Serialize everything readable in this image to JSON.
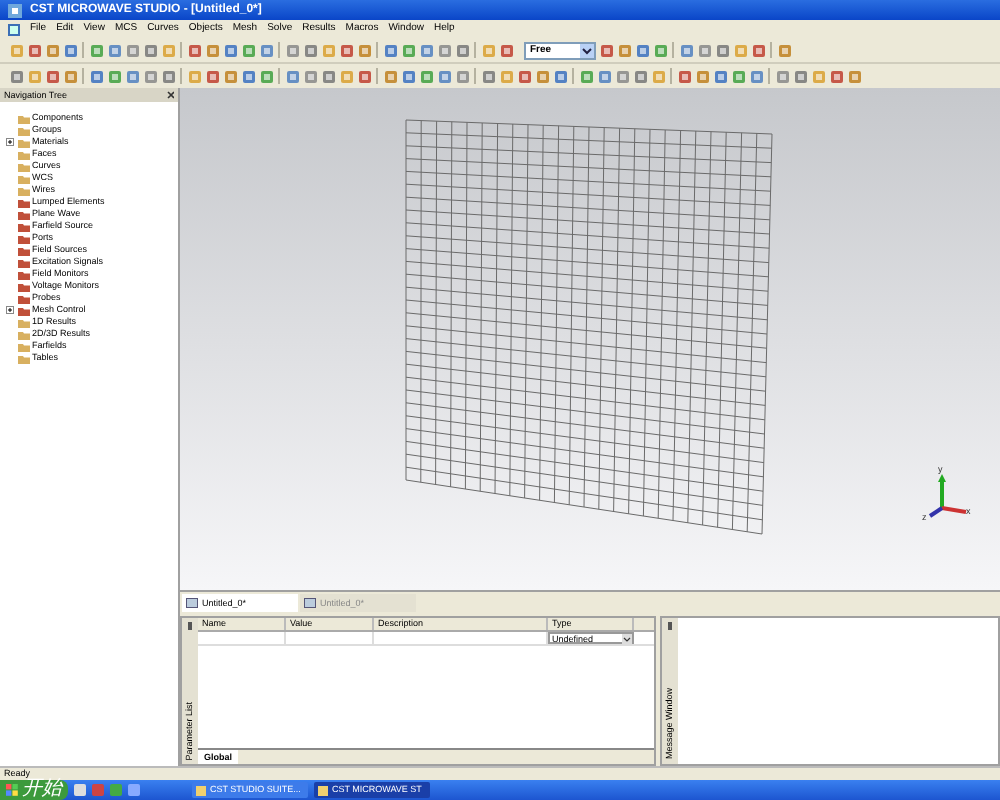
{
  "window": {
    "title": "CST MICROWAVE STUDIO - [Untitled_0*]"
  },
  "menu": [
    "File",
    "Edit",
    "View",
    "MCS",
    "Curves",
    "Objects",
    "Mesh",
    "Solve",
    "Results",
    "Macros",
    "Window",
    "Help"
  ],
  "toolbar": {
    "view_mode": "Free"
  },
  "navigation_tree": {
    "title": "Navigation Tree",
    "items": [
      {
        "label": "Components",
        "expandable": false
      },
      {
        "label": "Groups",
        "expandable": false
      },
      {
        "label": "Materials",
        "expandable": true
      },
      {
        "label": "Faces",
        "expandable": false
      },
      {
        "label": "Curves",
        "expandable": false
      },
      {
        "label": "WCS",
        "expandable": false
      },
      {
        "label": "Wires",
        "expandable": false
      },
      {
        "label": "Lumped Elements",
        "expandable": false
      },
      {
        "label": "Plane Wave",
        "expandable": false
      },
      {
        "label": "Farfield Source",
        "expandable": false
      },
      {
        "label": "Ports",
        "expandable": false
      },
      {
        "label": "Field Sources",
        "expandable": false
      },
      {
        "label": "Excitation Signals",
        "expandable": false
      },
      {
        "label": "Field Monitors",
        "expandable": false
      },
      {
        "label": "Voltage Monitors",
        "expandable": false
      },
      {
        "label": "Probes",
        "expandable": false
      },
      {
        "label": "Mesh Control",
        "expandable": true
      },
      {
        "label": "1D Results",
        "expandable": false
      },
      {
        "label": "2D/3D Results",
        "expandable": false
      },
      {
        "label": "Farfields",
        "expandable": false
      },
      {
        "label": "Tables",
        "expandable": false
      }
    ]
  },
  "axes": [
    "y",
    "z",
    "x"
  ],
  "document_tabs": [
    {
      "label": "Untitled_0*",
      "selected": true
    },
    {
      "label": "Untitled_0*",
      "selected": false
    }
  ],
  "parameter_list": {
    "title": "Parameter List",
    "columns": [
      "Name",
      "Value",
      "Description",
      "Type"
    ],
    "rows": [
      {
        "type": "Undefined"
      }
    ],
    "tabs": [
      {
        "label": "Global",
        "selected": true
      }
    ]
  },
  "message_window": {
    "title": "Message Window"
  },
  "status_bar": "Ready",
  "taskbar": {
    "start": "开始",
    "tasks": [
      {
        "label": "CST STUDIO SUITE...",
        "selected": false
      },
      {
        "label": "CST MICROWAVE ST",
        "selected": true
      }
    ]
  }
}
